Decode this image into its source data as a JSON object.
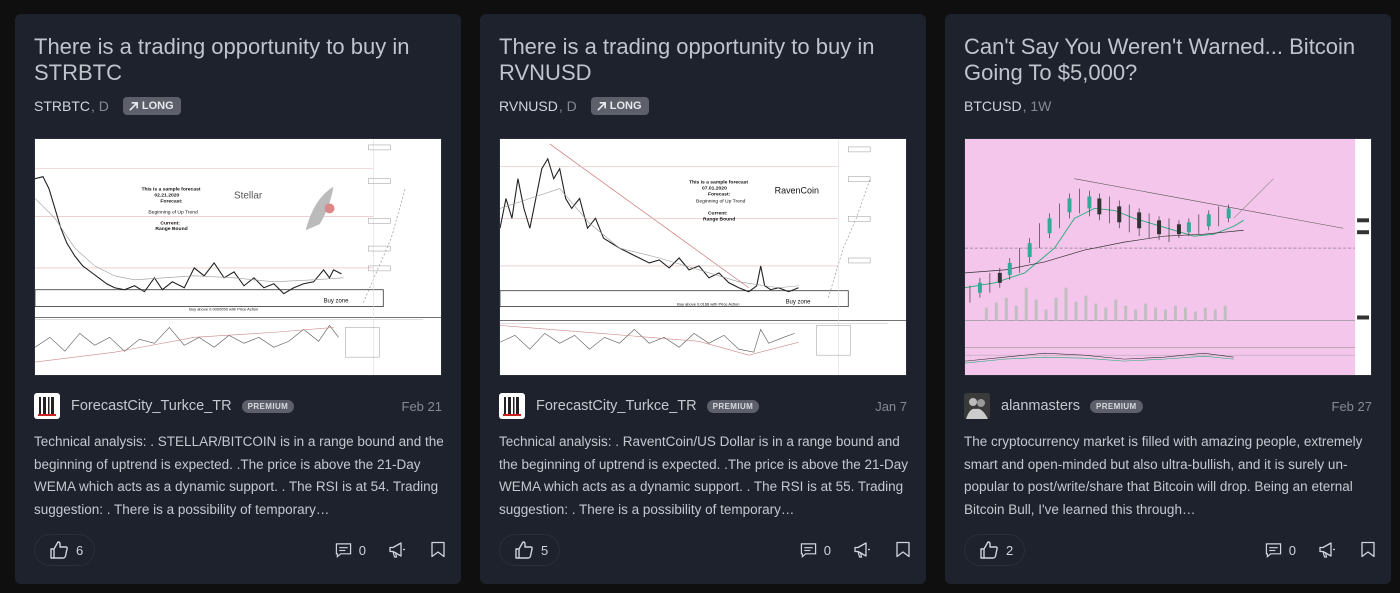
{
  "cards": [
    {
      "title": "There is a trading opportunity to buy in STRBTC",
      "symbol": "STRBTC",
      "interval": ", D",
      "badge": "LONG",
      "chart": {
        "forecast_lines": [
          "This is a sample forecast",
          "02.21.2020",
          "Forecast:",
          "Beginning of Up Trend",
          "Current:",
          "Range Bound"
        ],
        "asset_label": "Stellar",
        "buy_zone": "Buy zone",
        "buy_above": "Buy above 0.0000050 with Price Action"
      },
      "author": "ForecastCity_Turkce_TR",
      "premium": "PREMIUM",
      "date": "Feb 21",
      "description": "Technical analysis: . STELLAR/BITCOIN is in a range bound and the beginning of uptrend is expected. .The price is above the 21-Day WEMA which acts as a dynamic support. . The RSI is at 54. Trading suggestion: . There is a possibility of temporary…",
      "likes": "6",
      "comments": "0"
    },
    {
      "title": "There is a trading opportunity to buy in RVNUSD",
      "symbol": "RVNUSD",
      "interval": ", D",
      "badge": "LONG",
      "chart": {
        "forecast_lines": [
          "This is a sample forecast",
          "07.01.2020",
          "Forecast:",
          "Beginning of Up Trend",
          "Current:",
          "Range Bound"
        ],
        "asset_label": "RavenCoin",
        "buy_zone": "Buy zone",
        "buy_above": "Buy above 0.0168 with Price Action"
      },
      "author": "ForecastCity_Turkce_TR",
      "premium": "PREMIUM",
      "date": "Jan 7",
      "description": "Technical analysis: . RaventCoin/US Dollar is in a range bound and the beginning of uptrend is expected. .The price is above the 21-Day WEMA which acts as a dynamic support. . The RSI is at 55. Trading suggestion: . There is a possibility of temporary…",
      "likes": "5",
      "comments": "0"
    },
    {
      "title": "Can't Say You Weren't Warned... Bitcoin Going To $5,000?",
      "symbol": "BTCUSD",
      "interval": ", 1W",
      "badge": "",
      "author": "alanmasters",
      "premium": "PREMIUM",
      "date": "Feb 27",
      "description": "The cryptocurrency market is filled with amazing people, extremely smart and open-minded but also ultra-bullish, and it is surely un-popular to post/write/share that Bitcoin will drop. Being an eternal Bitcoin Bull, I've learned this through…",
      "likes": "2",
      "comments": "0"
    }
  ],
  "icons": {
    "like": "thumbs-up-icon",
    "comment": "comment-icon",
    "share": "megaphone-share-icon",
    "bookmark": "bookmark-icon",
    "long": "arrow-up-right-icon"
  },
  "colors": {
    "background": "#0f0f0f",
    "card": "#1e222d",
    "badge": "#5d606b",
    "chart3_bg": "#f5c6ec"
  }
}
